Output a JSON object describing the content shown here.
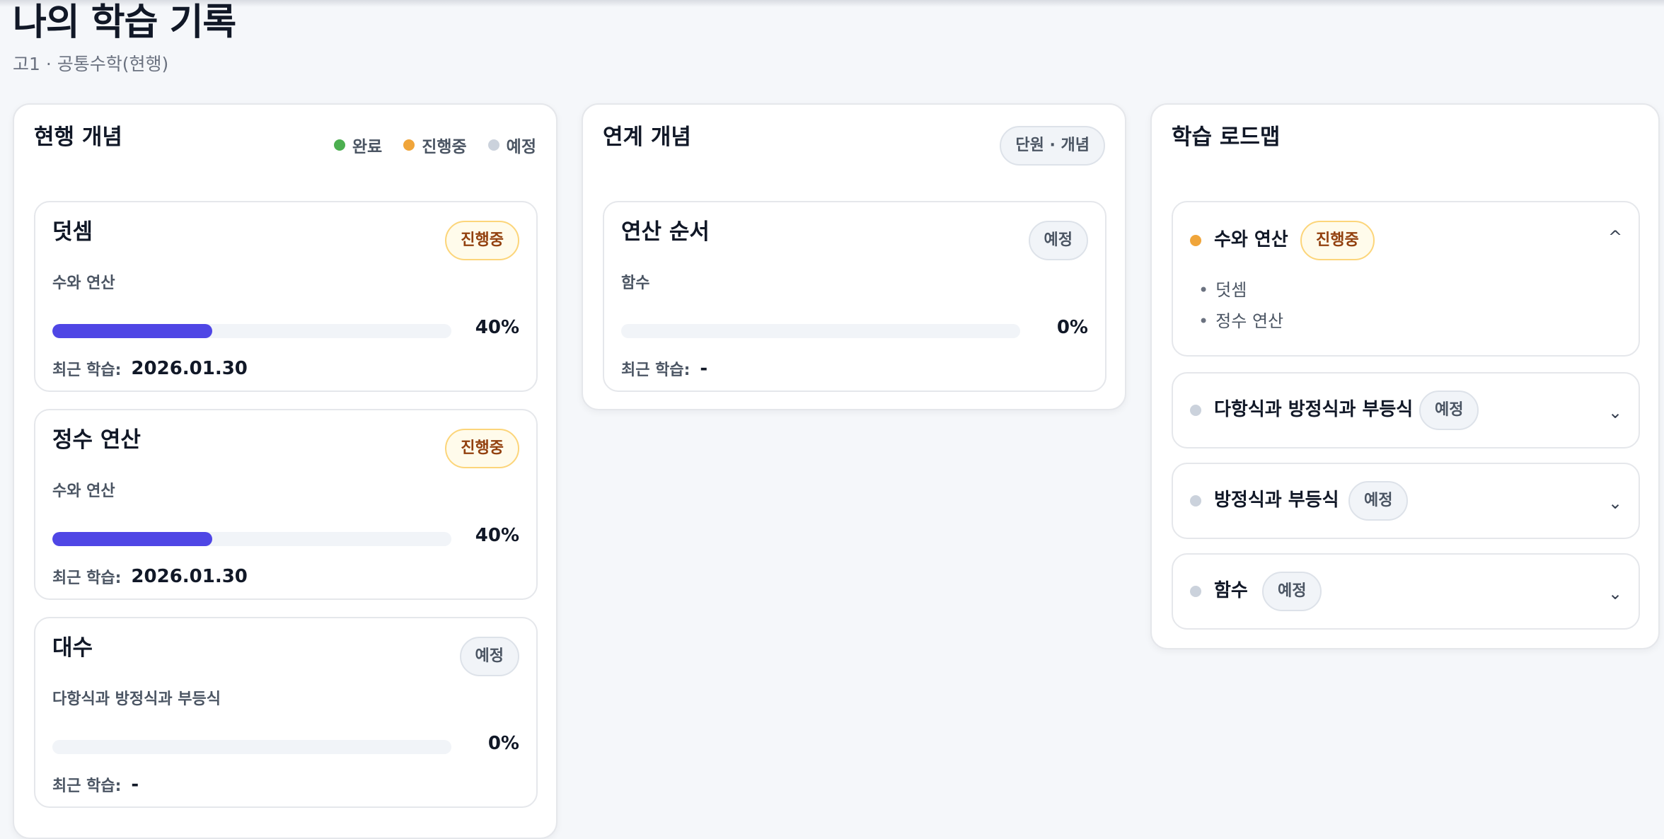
{
  "header": {
    "title": "나의 학습 기록",
    "subtitle": "고1 · 공통수학(현행)"
  },
  "current": {
    "title": "현행 개념",
    "legend": {
      "done": "완료",
      "progress": "진행중",
      "planned": "예정",
      "colors": {
        "done": "#4caf50",
        "progress": "#f0a53a",
        "planned": "#cbd2dc"
      }
    },
    "cards": [
      {
        "title": "덧셈",
        "status": "진행중",
        "unit": "수와 연산",
        "progress": 40,
        "progress_label": "40%",
        "recent_label": "최근 학습:",
        "recent": "2026.01.30"
      },
      {
        "title": "정수 연산",
        "status": "진행중",
        "unit": "수와 연산",
        "progress": 40,
        "progress_label": "40%",
        "recent_label": "최근 학습:",
        "recent": "2026.01.30"
      },
      {
        "title": "대수",
        "status": "예정",
        "unit": "다항식과 방정식과 부등식",
        "progress": 0,
        "progress_label": "0%",
        "recent_label": "최근 학습:",
        "recent": "-"
      }
    ]
  },
  "linked": {
    "title": "연계 개념",
    "filter_chip": "단원 · 개념",
    "cards": [
      {
        "title": "연산 순서",
        "status": "예정",
        "unit": "함수",
        "progress": 0,
        "progress_label": "0%",
        "recent_label": "최근 학습:",
        "recent": "-"
      }
    ]
  },
  "roadmap": {
    "title": "학습 로드맵",
    "items": [
      {
        "title": "수와 연산",
        "status": "진행중",
        "expanded": true,
        "chevron": "^",
        "children": [
          "덧셈",
          "정수 연산"
        ]
      },
      {
        "title": "다항식과 방정식과 부등식",
        "status": "예정",
        "expanded": false,
        "chevron": "⌄"
      },
      {
        "title": "방정식과 부등식",
        "status": "예정",
        "expanded": false,
        "chevron": "⌄"
      },
      {
        "title": "함수",
        "status": "예정",
        "expanded": false,
        "chevron": "⌄"
      }
    ]
  },
  "icons": {
    "bullet": "•"
  },
  "colors": {
    "accent": "#4f46e5"
  }
}
